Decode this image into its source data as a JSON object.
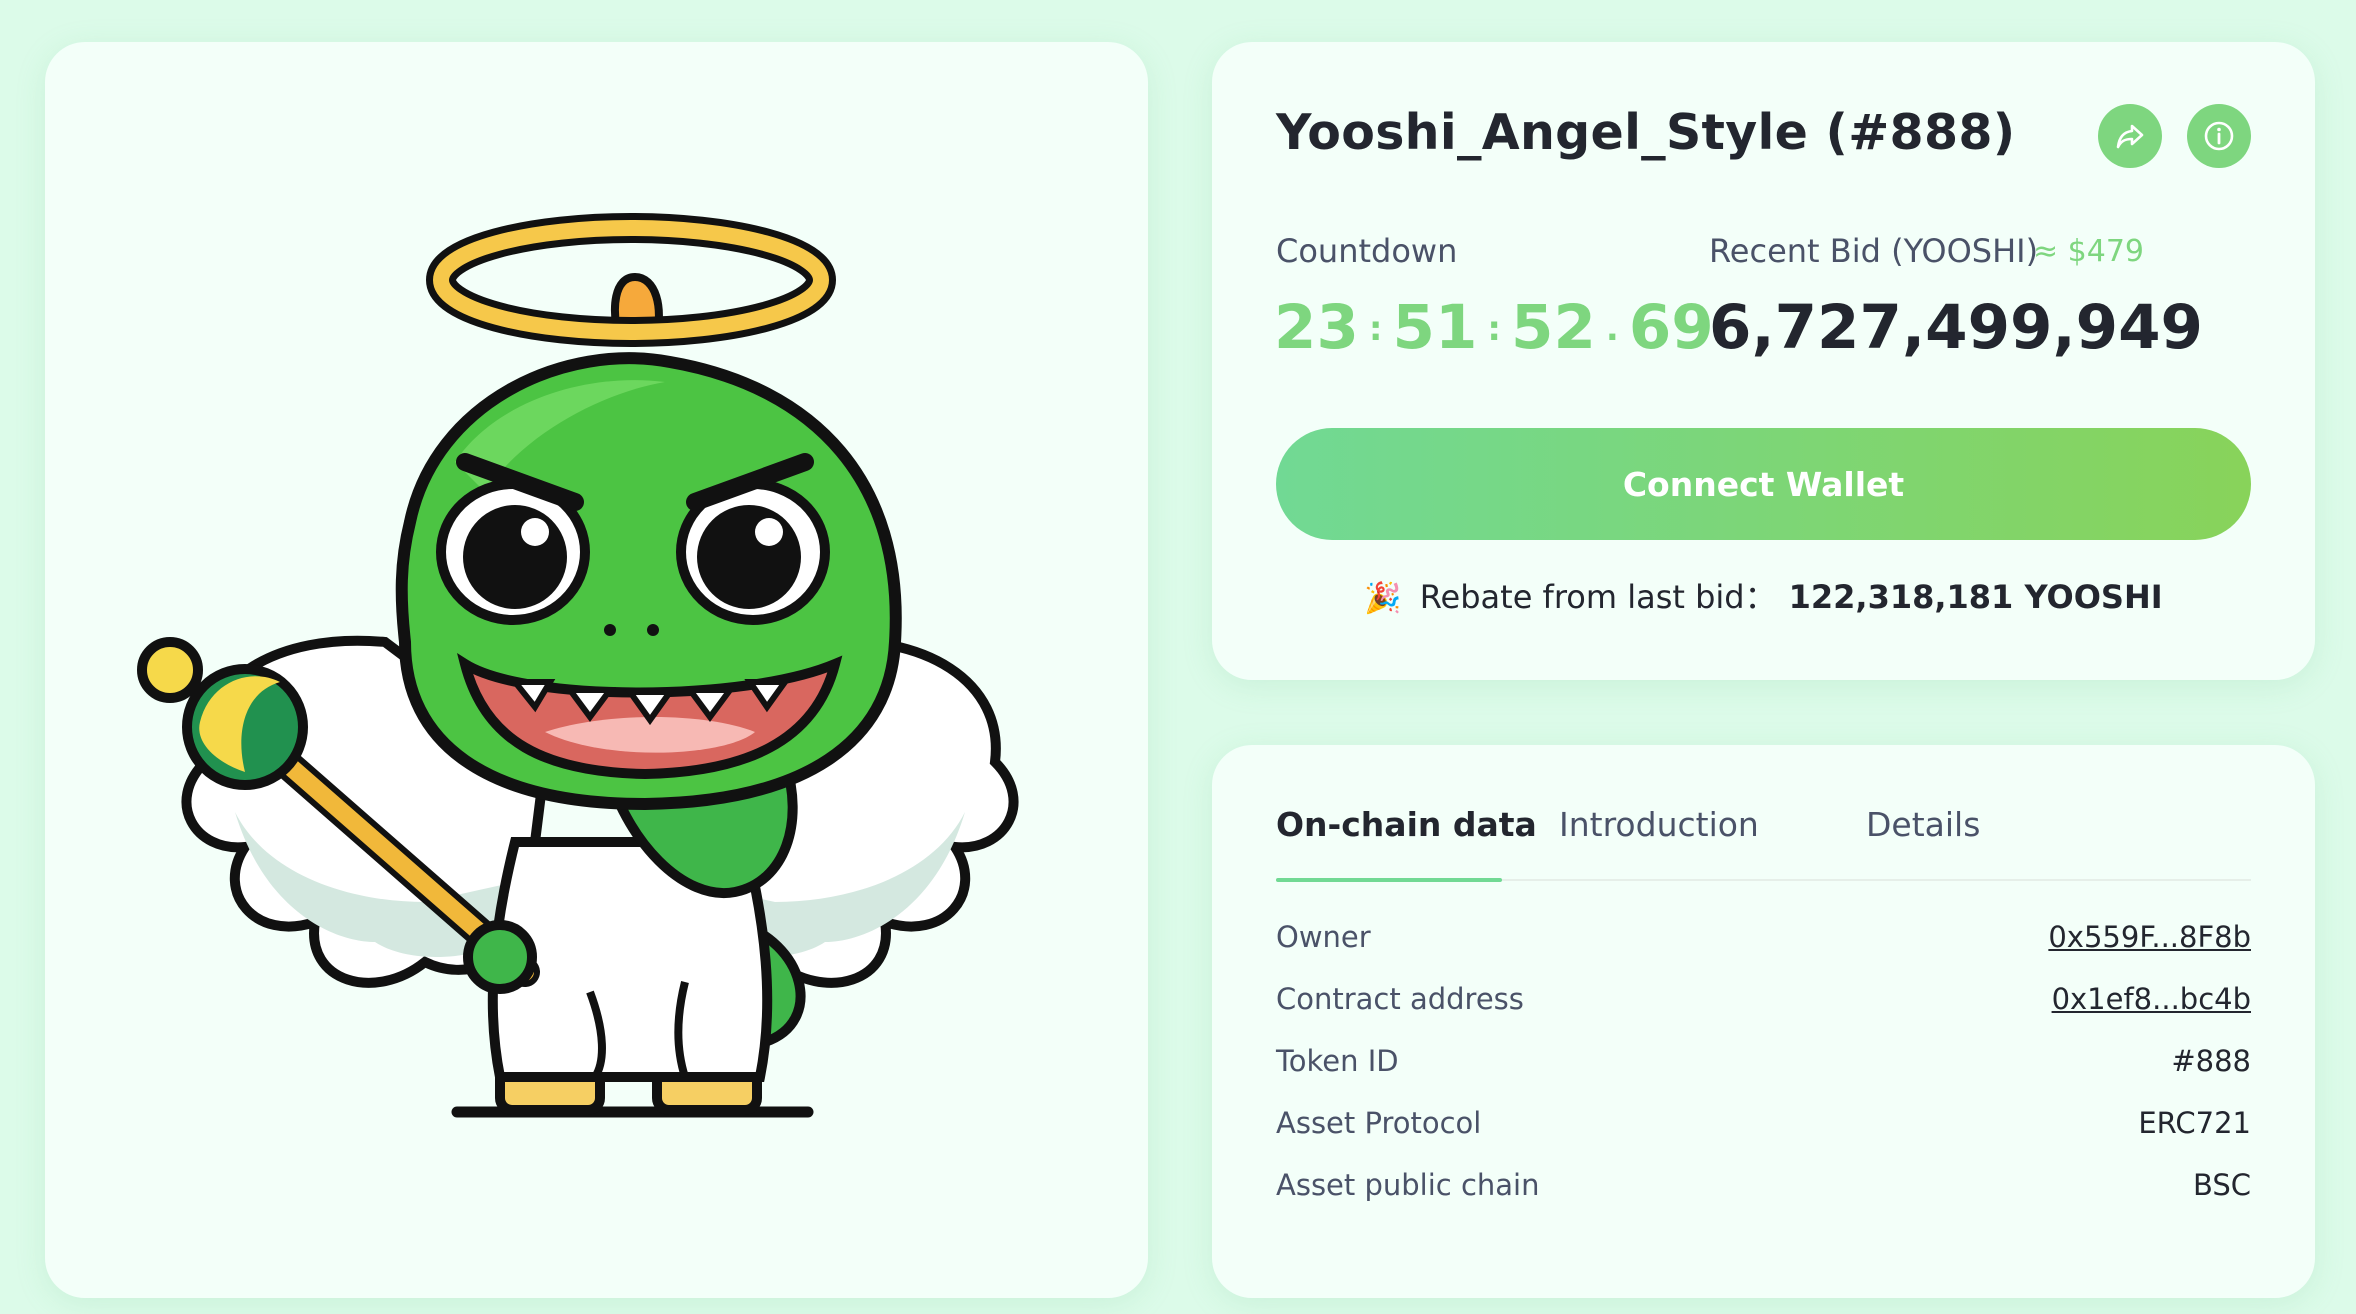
{
  "nft": {
    "title": "Yooshi_Angel_Style (#888)"
  },
  "icons": {
    "share": "share-icon",
    "info": "info-icon",
    "party": "party-popper-icon"
  },
  "colors": {
    "accent": "#7ed67f",
    "button_gradient_start": "#71d994",
    "button_gradient_end": "#88d35a",
    "background": "#dcfbe9",
    "card": "#f3fff9"
  },
  "auction": {
    "countdown_label": "Countdown",
    "countdown": {
      "hours": "23",
      "minutes": "51",
      "seconds": "52",
      "centis": "69"
    },
    "recent_bid_label": "Recent Bid (YOOSHI)",
    "recent_bid_usd": "≈ $479",
    "recent_bid_value": "6,727,499,949",
    "connect_label": "Connect Wallet",
    "rebate_label": "Rebate from last bid：",
    "rebate_value": "122,318,181 YOOSHI"
  },
  "tabs": [
    {
      "label": "On-chain data",
      "active": true
    },
    {
      "label": "Introduction",
      "active": false
    },
    {
      "label": "Details",
      "active": false
    }
  ],
  "onchain": [
    {
      "key": "Owner",
      "value": "0x559F...8F8b",
      "link": true
    },
    {
      "key": "Contract address",
      "value": "0x1ef8...bc4b",
      "link": true
    },
    {
      "key": "Token ID",
      "value": "#888",
      "link": false
    },
    {
      "key": "Asset Protocol",
      "value": "ERC721",
      "link": false
    },
    {
      "key": "Asset public chain",
      "value": "BSC",
      "link": false
    }
  ]
}
